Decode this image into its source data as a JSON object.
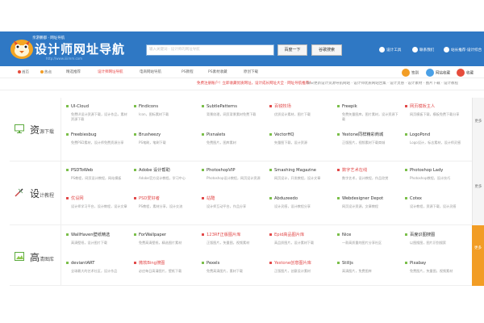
{
  "header": {
    "logo_small": "亲游鹏都 · 网址导航",
    "title": "设计师网址导航",
    "url": "http://www.iiiimm.com",
    "search_placeholder": "输入关键词 · 设计师的网址导航",
    "search_buttons": [
      "百度一下",
      "谷歌搜索"
    ],
    "links": [
      "设计工具",
      "联系我们",
      "站长推荐·设计综合"
    ],
    "colors": {
      "header_bg": "#2f78c4",
      "accent_red": "#e23d3d",
      "orange": "#f29d25"
    }
  },
  "nav": {
    "items": [
      "首页",
      "热点",
      "精选推荐",
      "设计师网址导航",
      "电商网站导航",
      "PS教程",
      "PS素材收藏",
      "原创下载"
    ],
    "right": [
      "签到",
      "网站收藏",
      "收藏"
    ]
  },
  "notice": {
    "red": "免费注册账户！立即收藏优质网址，设计成长网址大全 · 网址导航推荐！",
    "gray": "每日更新设计资源导航网站 · 设计师优质网站合集 · 设计灵感 · 设计素材 · 图片下载 · 设计教程"
  },
  "sections": [
    {
      "big": "资",
      "small": "源下载",
      "icon": "monitor-icon",
      "items": [
        {
          "title": "UI-Cloud",
          "desc": "免费UI设计资源下载，设计作品，素材资源下载",
          "red": false
        },
        {
          "title": "Findicons",
          "desc": "Icon，图标素材下载",
          "red": false
        },
        {
          "title": "SubtlePatterns",
          "desc": "背景纹理，网页背景素材免费下载",
          "red": false
        },
        {
          "title": "百锐牧场",
          "desc": "优质设计素材，图片下载",
          "red": true
        },
        {
          "title": "Freepik",
          "desc": "免费矢量图库，图片素材，设计资源下载",
          "red": false
        },
        {
          "title": "网页模板主人",
          "desc": "网页模板下载，模板免费下载分享",
          "red": true
        },
        {
          "title": "Freebiesbug",
          "desc": "免费PSD素材，设计师免费资源分享",
          "red": false
        },
        {
          "title": "Brusheezy",
          "desc": "PS笔刷，笔刷下载",
          "red": false
        },
        {
          "title": "Pixnalets",
          "desc": "免费图片，图库素材",
          "red": false
        },
        {
          "title": "VectorHQ",
          "desc": "矢量图下载，设计资源",
          "red": false
        },
        {
          "title": "Yestone同样精彩商城",
          "desc": "正版图片，视频素材下载商城",
          "red": false
        },
        {
          "title": "LogoPond",
          "desc": "Logo设计，标志素材，设计师灵感",
          "red": false
        }
      ]
    },
    {
      "big": "设",
      "small": "计教程",
      "icon": "brush-icon",
      "items": [
        {
          "title": "PSDToWeb",
          "desc": "PS教程，网页设计教程，网站模板",
          "red": false
        },
        {
          "title": "Adobe 设计帮助",
          "desc": "Adobe官方设计教程，学习中心",
          "red": false
        },
        {
          "title": "PhotoshopVIP",
          "desc": "Photoshop设计教程，网页设计资源",
          "red": false
        },
        {
          "title": "Smashing Magazine",
          "desc": "网页设计，开发教程，设计文章",
          "red": false
        },
        {
          "title": "数字艺术在线",
          "desc": "数字艺术，设计教程，作品欣赏",
          "red": true
        },
        {
          "title": "Photoshop Lady",
          "desc": "Photoshop教程，设计技巧",
          "red": false
        },
        {
          "title": "优设网",
          "desc": "设计师学习平台，设计教程，设计文章",
          "red": true
        },
        {
          "title": "PSD爱好者",
          "desc": "PS教程，素材分享，设计交流",
          "red": true
        },
        {
          "title": "站酷",
          "desc": "设计师互动平台，作品分享",
          "red": true
        },
        {
          "title": "Abduzeedo",
          "desc": "设计灵感，设计教程分享",
          "red": false
        },
        {
          "title": "Webdesigner Depot",
          "desc": "网页设计资源，文章教程",
          "red": false
        },
        {
          "title": "Cotex",
          "desc": "设计教程，资源下载，设计灵感",
          "red": false
        }
      ]
    },
    {
      "big": "高",
      "small": "清图库",
      "icon": "image-icon",
      "items": [
        {
          "title": "WallHaven壁纸精选",
          "desc": "高清壁纸，设计图片下载",
          "red": false
        },
        {
          "title": "ForWallpaper",
          "desc": "免费高清壁纸，精选图片素材",
          "red": false
        },
        {
          "title": "123RF正版图片库",
          "desc": "正版图片，矢量图，视频素材",
          "red": true
        },
        {
          "title": "Epid高品图片库",
          "desc": "高品质图片，设计素材下载",
          "red": true
        },
        {
          "title": "Nice",
          "desc": "一款高质量的图片分享社区",
          "red": false
        },
        {
          "title": "百度识图搜图",
          "desc": "以图搜图，图片识别搜索",
          "red": false
        },
        {
          "title": "deviantART",
          "desc": "全球最大的艺术社区，设计作品",
          "red": false
        },
        {
          "title": "微软Bing搜图",
          "desc": "必应每日高清图片，壁纸下载",
          "red": true
        },
        {
          "title": "Pexels",
          "desc": "免费高清图片，素材下载",
          "red": false
        },
        {
          "title": "Yestone创意图片库",
          "desc": "正版图片，创意设计素材",
          "red": true
        },
        {
          "title": "Stilljs",
          "desc": "高清图片，免费图库",
          "red": false
        },
        {
          "title": "Pixabay",
          "desc": "免费图片，矢量图，视频素材",
          "red": false
        }
      ]
    }
  ],
  "sidebar": [
    "更多",
    "更多",
    "更多"
  ]
}
